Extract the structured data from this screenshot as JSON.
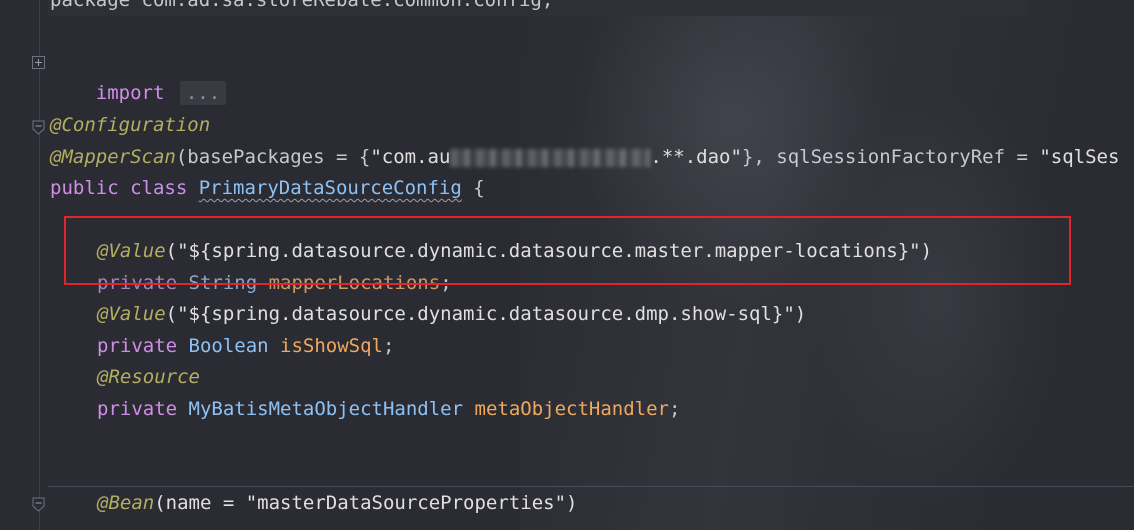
{
  "editor": {
    "lines": {
      "package_line": "package com.ad.sa.storeRebate.common.config;",
      "import_kw": "import",
      "import_fold": "...",
      "configuration": "@Configuration",
      "mapperscan_ann": "@MapperScan",
      "mapperscan_open": "(",
      "mapperscan_attr": "basePackages = {",
      "mapperscan_str_start": "\"com.au",
      "mapperscan_str_end": ".**.dao\"",
      "mapperscan_mid": "}, ",
      "mapperscan_attr2": "sqlSessionFactoryRef = ",
      "mapperscan_str2": "\"sqlSes",
      "public_kw": "public class ",
      "class_name": "PrimaryDataSourceConfig",
      "brace_open": " {",
      "value1_ann": "@Value",
      "value1_str": "(\"${spring.datasource.dynamic.datasource.master.mapper-locations}\")",
      "private1_kw": "private ",
      "private1_type": "String ",
      "private1_field": "mapperLocations",
      "semi": ";",
      "value2_ann": "@Value",
      "value2_str": "(\"${spring.datasource.dynamic.datasource.dmp.show-sql}\")",
      "private2_kw": "private ",
      "private2_type": "Boolean ",
      "private2_field": "isShowSql",
      "resource_ann": "@Resource",
      "private3_kw": "private ",
      "private3_type": "MyBatisMetaObjectHandler ",
      "private3_field": "metaObjectHandler",
      "bean_ann": "@Bean",
      "bean_args": "(name = \"masterDataSourceProperties\")"
    }
  },
  "colors": {
    "background": "#2b2c33",
    "keyword": "#cf8ee8",
    "annotation": "#b3ae60",
    "class": "#8dc2f5",
    "field": "#f0a95b",
    "highlight_box": "#e0262c"
  }
}
